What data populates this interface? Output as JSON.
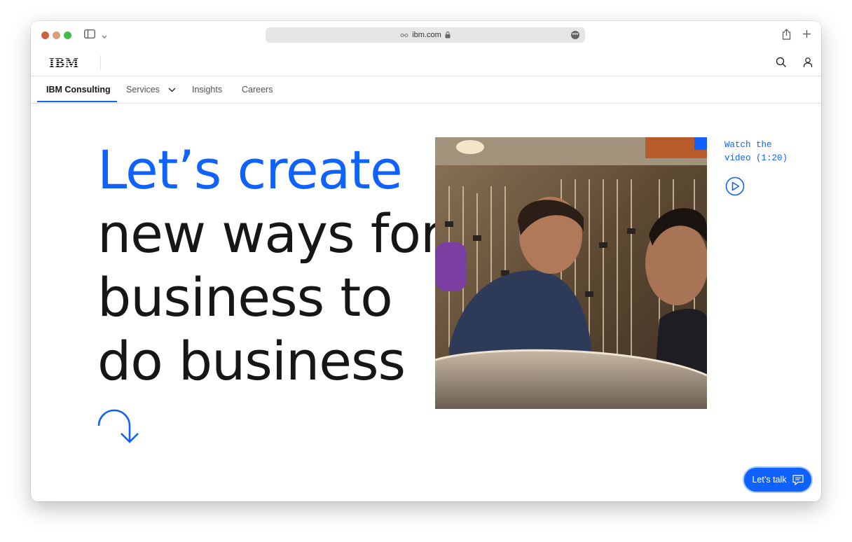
{
  "browser": {
    "url": "ibm.com",
    "icons": [
      "sidebar-icon",
      "chevron-down-icon",
      "lock-icon",
      "more-icon",
      "share-icon",
      "new-tab-icon"
    ]
  },
  "masthead": {
    "logo": "IBM",
    "icons": [
      "search-icon",
      "user-icon"
    ]
  },
  "subnav": {
    "items": [
      {
        "label": "IBM Consulting",
        "active": true
      },
      {
        "label": "Services",
        "dropdown": true
      },
      {
        "label": "Insights"
      },
      {
        "label": "Careers"
      }
    ]
  },
  "hero": {
    "lines": [
      "Let’s create",
      "new ways for",
      "business to",
      "do business"
    ],
    "accent_line": 0,
    "watch_label_1": "Watch the",
    "watch_label_2": "video (1:20)",
    "cta": "Let’s talk"
  },
  "colors": {
    "accent": "#0f62fe",
    "text": "#161616",
    "muted": "#525252",
    "border": "#e0e0e0"
  }
}
